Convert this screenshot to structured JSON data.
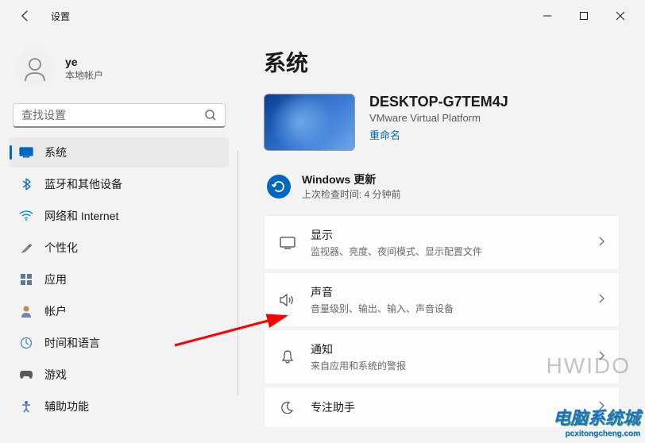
{
  "app_title": "设置",
  "user": {
    "name": "ye",
    "type": "本地帐户"
  },
  "search": {
    "placeholder": "查找设置"
  },
  "sidebar": {
    "items": [
      {
        "label": "系统"
      },
      {
        "label": "蓝牙和其他设备"
      },
      {
        "label": "网络和 Internet"
      },
      {
        "label": "个性化"
      },
      {
        "label": "应用"
      },
      {
        "label": "帐户"
      },
      {
        "label": "时间和语言"
      },
      {
        "label": "游戏"
      },
      {
        "label": "辅助功能"
      }
    ]
  },
  "page_title": "系统",
  "device": {
    "name": "DESKTOP-G7TEM4J",
    "platform": "VMware Virtual Platform",
    "rename": "重命名"
  },
  "update": {
    "title": "Windows 更新",
    "sub": "上次检查时间: 4 分钟前"
  },
  "settings": [
    {
      "title": "显示",
      "sub": "监视器、亮度、夜间模式、显示配置文件"
    },
    {
      "title": "声音",
      "sub": "音量级别、输出、输入、声音设备"
    },
    {
      "title": "通知",
      "sub": "来自应用和系统的警报"
    },
    {
      "title": "专注助手",
      "sub": ""
    }
  ],
  "watermark": {
    "line1": "电脑系统城",
    "line2": "pcxitongcheng.com"
  },
  "watermark2": "HWIDO"
}
